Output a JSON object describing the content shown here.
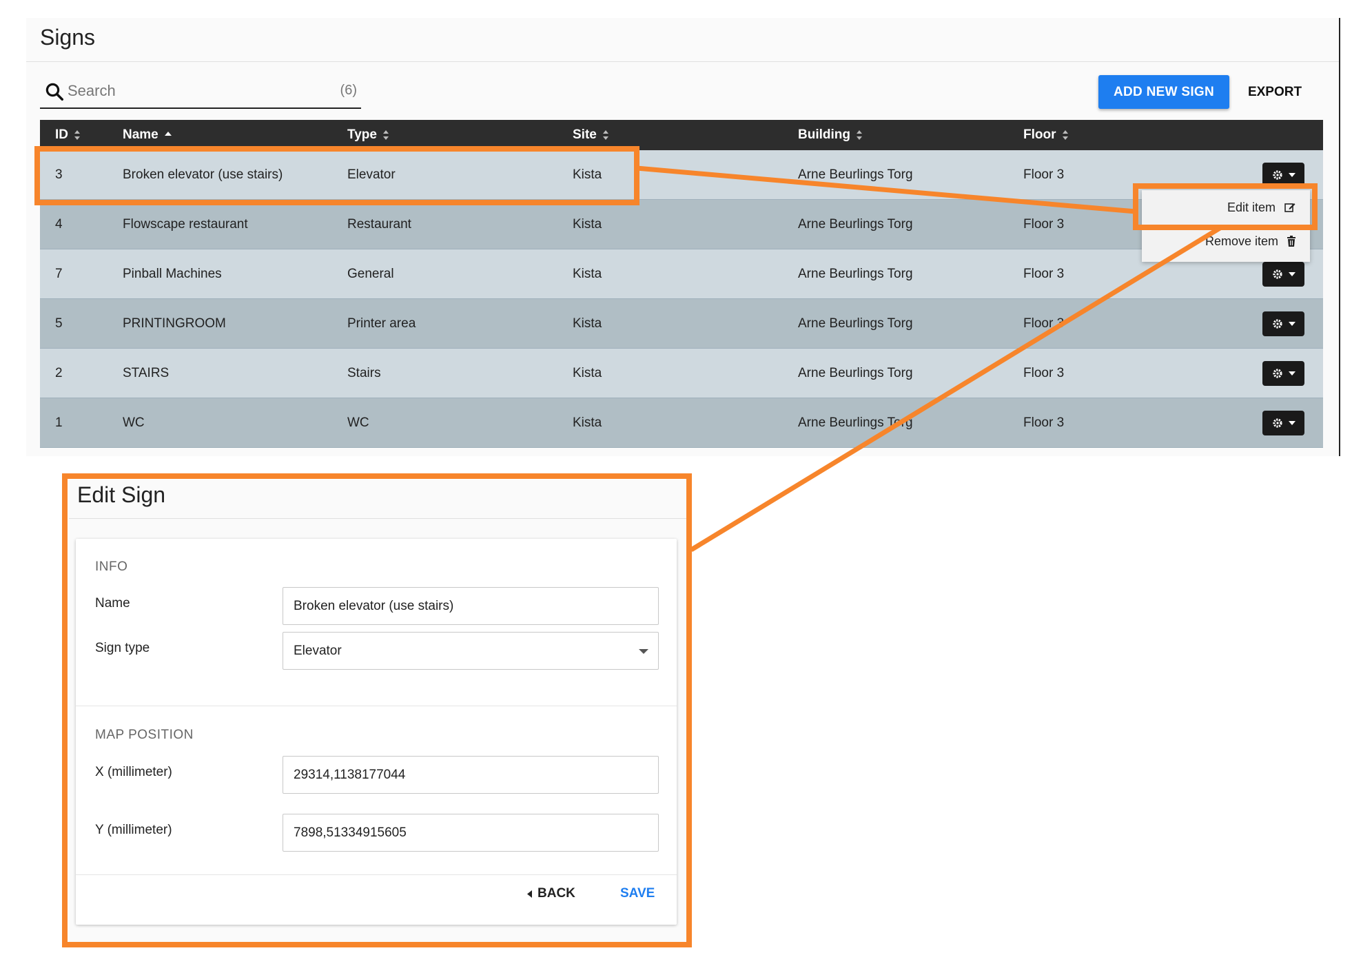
{
  "page": {
    "title": "Signs"
  },
  "search": {
    "placeholder": "Search",
    "count": "(6)"
  },
  "actions": {
    "add_label": "ADD NEW SIGN",
    "export_label": "EXPORT"
  },
  "table": {
    "columns": [
      "ID",
      "Name",
      "Type",
      "Site",
      "Building",
      "Floor"
    ],
    "sorted_column": "Name",
    "rows": [
      {
        "id": "3",
        "name": "Broken elevator (use stairs)",
        "type": "Elevator",
        "site": "Kista",
        "building": "Arne Beurlings Torg",
        "floor": "Floor 3"
      },
      {
        "id": "4",
        "name": "Flowscape restaurant",
        "type": "Restaurant",
        "site": "Kista",
        "building": "Arne Beurlings Torg",
        "floor": "Floor 3"
      },
      {
        "id": "7",
        "name": "Pinball Machines",
        "type": "General",
        "site": "Kista",
        "building": "Arne Beurlings Torg",
        "floor": "Floor 3"
      },
      {
        "id": "5",
        "name": "PRINTINGROOM",
        "type": "Printer area",
        "site": "Kista",
        "building": "Arne Beurlings Torg",
        "floor": "Floor 3"
      },
      {
        "id": "2",
        "name": "STAIRS",
        "type": "Stairs",
        "site": "Kista",
        "building": "Arne Beurlings Torg",
        "floor": "Floor 3"
      },
      {
        "id": "1",
        "name": "WC",
        "type": "WC",
        "site": "Kista",
        "building": "Arne Beurlings Torg",
        "floor": "Floor 3"
      }
    ]
  },
  "row_menu": {
    "edit_label": "Edit item",
    "remove_label": "Remove item"
  },
  "edit_form": {
    "title": "Edit Sign",
    "info_section": "INFO",
    "name_label": "Name",
    "name_value": "Broken elevator (use stairs)",
    "sign_type_label": "Sign type",
    "sign_type_value": "Elevator",
    "map_section": "MAP POSITION",
    "x_label": "X (millimeter)",
    "x_value": "29314,1138177044",
    "y_label": "Y (millimeter)",
    "y_value": "7898,51334915605",
    "back_label": "BACK",
    "save_label": "SAVE"
  },
  "colors": {
    "accent": "#1e7ef0",
    "highlight": "#f7852b",
    "header": "#2d2d2d"
  },
  "icons": {
    "search": "search-icon",
    "gear": "gear-icon",
    "edit": "edit-icon",
    "trash": "trash-icon",
    "sort": "sort-icon"
  }
}
